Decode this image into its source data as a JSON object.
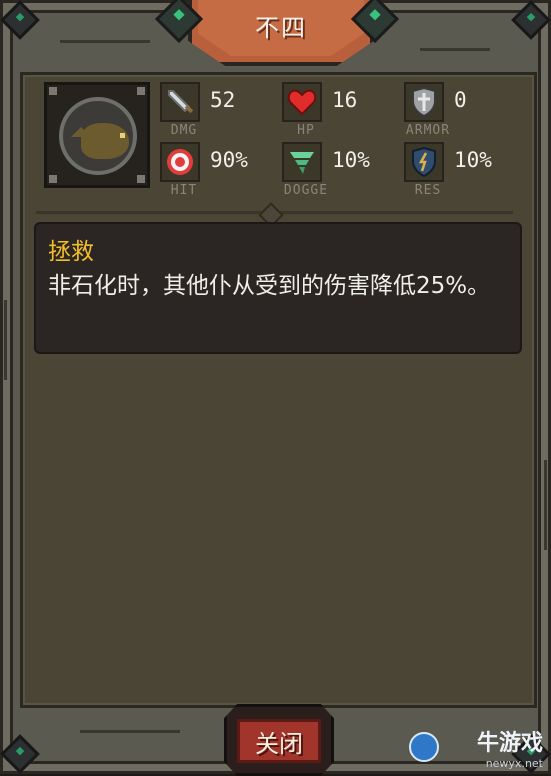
{
  "title": "不四",
  "portrait_icon": "wolf-portrait",
  "stats": [
    {
      "id": "dmg",
      "icon": "sword-icon",
      "value": "52",
      "label": "DMG",
      "color": "#cfd3d6"
    },
    {
      "id": "hp",
      "icon": "heart-icon",
      "value": "16",
      "label": "HP",
      "color": "#e12c2c"
    },
    {
      "id": "armor",
      "icon": "shield-icon",
      "value": "0",
      "label": "ARMOR",
      "color": "#9ea2a4"
    },
    {
      "id": "hit",
      "icon": "target-icon",
      "value": "90%",
      "label": "HIT",
      "color": "#e23d3d"
    },
    {
      "id": "dodge",
      "icon": "tornado-icon",
      "value": "10%",
      "label": "DOGGE",
      "color": "#57c287"
    },
    {
      "id": "res",
      "icon": "resist-shield-icon",
      "value": "10%",
      "label": "RES",
      "color": "#3f6fa0"
    }
  ],
  "skill": {
    "name": "拯救",
    "description": "非石化时，其他仆从受到的伤害降低25%。",
    "name_color": "#f3be2a"
  },
  "close_button": {
    "label": "关闭",
    "color": "#a2352b"
  },
  "watermark": {
    "text": "牛游戏",
    "url_text": "newyx.net"
  }
}
